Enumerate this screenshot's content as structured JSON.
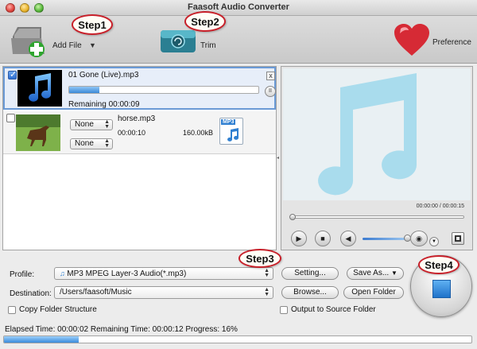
{
  "window": {
    "title": "Faasoft Audio Converter"
  },
  "toolbar": {
    "add_file_label": "Add File",
    "trim_label": "Trim",
    "preference_label": "Preference"
  },
  "callouts": {
    "step1": "Step1",
    "step2": "Step2",
    "step3": "Step3",
    "step4": "Step4"
  },
  "files": [
    {
      "name": "01 Gone (Live).mp3",
      "checked": true,
      "progress": 0.16,
      "remaining": "Remaining 00:00:09",
      "close": "x",
      "pause": "II",
      "thumbnail": "music-note-icon"
    },
    {
      "name": "horse.mp3",
      "checked": false,
      "subtitle_select": "None",
      "audio_select": "None",
      "duration": "00:00:10",
      "size": "160.00kB",
      "format_badge": "MP3",
      "thumbnail": "horse-photo"
    }
  ],
  "preview": {
    "time": "00:00:00 / 00:00:15",
    "seek_position": 0.0,
    "volume_level": 0.95
  },
  "form": {
    "profile_label": "Profile:",
    "profile_value": "MP3 MPEG Layer-3 Audio(*.mp3)",
    "setting_button": "Setting...",
    "save_as_button": "Save As...",
    "destination_label": "Destination:",
    "destination_value": "/Users/faasoft/Music",
    "browse_button": "Browse...",
    "open_folder_button": "Open Folder",
    "copy_folder_label": "Copy Folder Structure",
    "output_source_label": "Output to Source Folder"
  },
  "status": {
    "text": "Elapsed Time: 00:00:02 Remaining Time: 00:00:12 Progress: 16%",
    "progress": 0.16
  },
  "colors": {
    "accent_blue": "#3b8ad8",
    "callout_red": "#c8202a",
    "preview_note": "#a9dced"
  }
}
